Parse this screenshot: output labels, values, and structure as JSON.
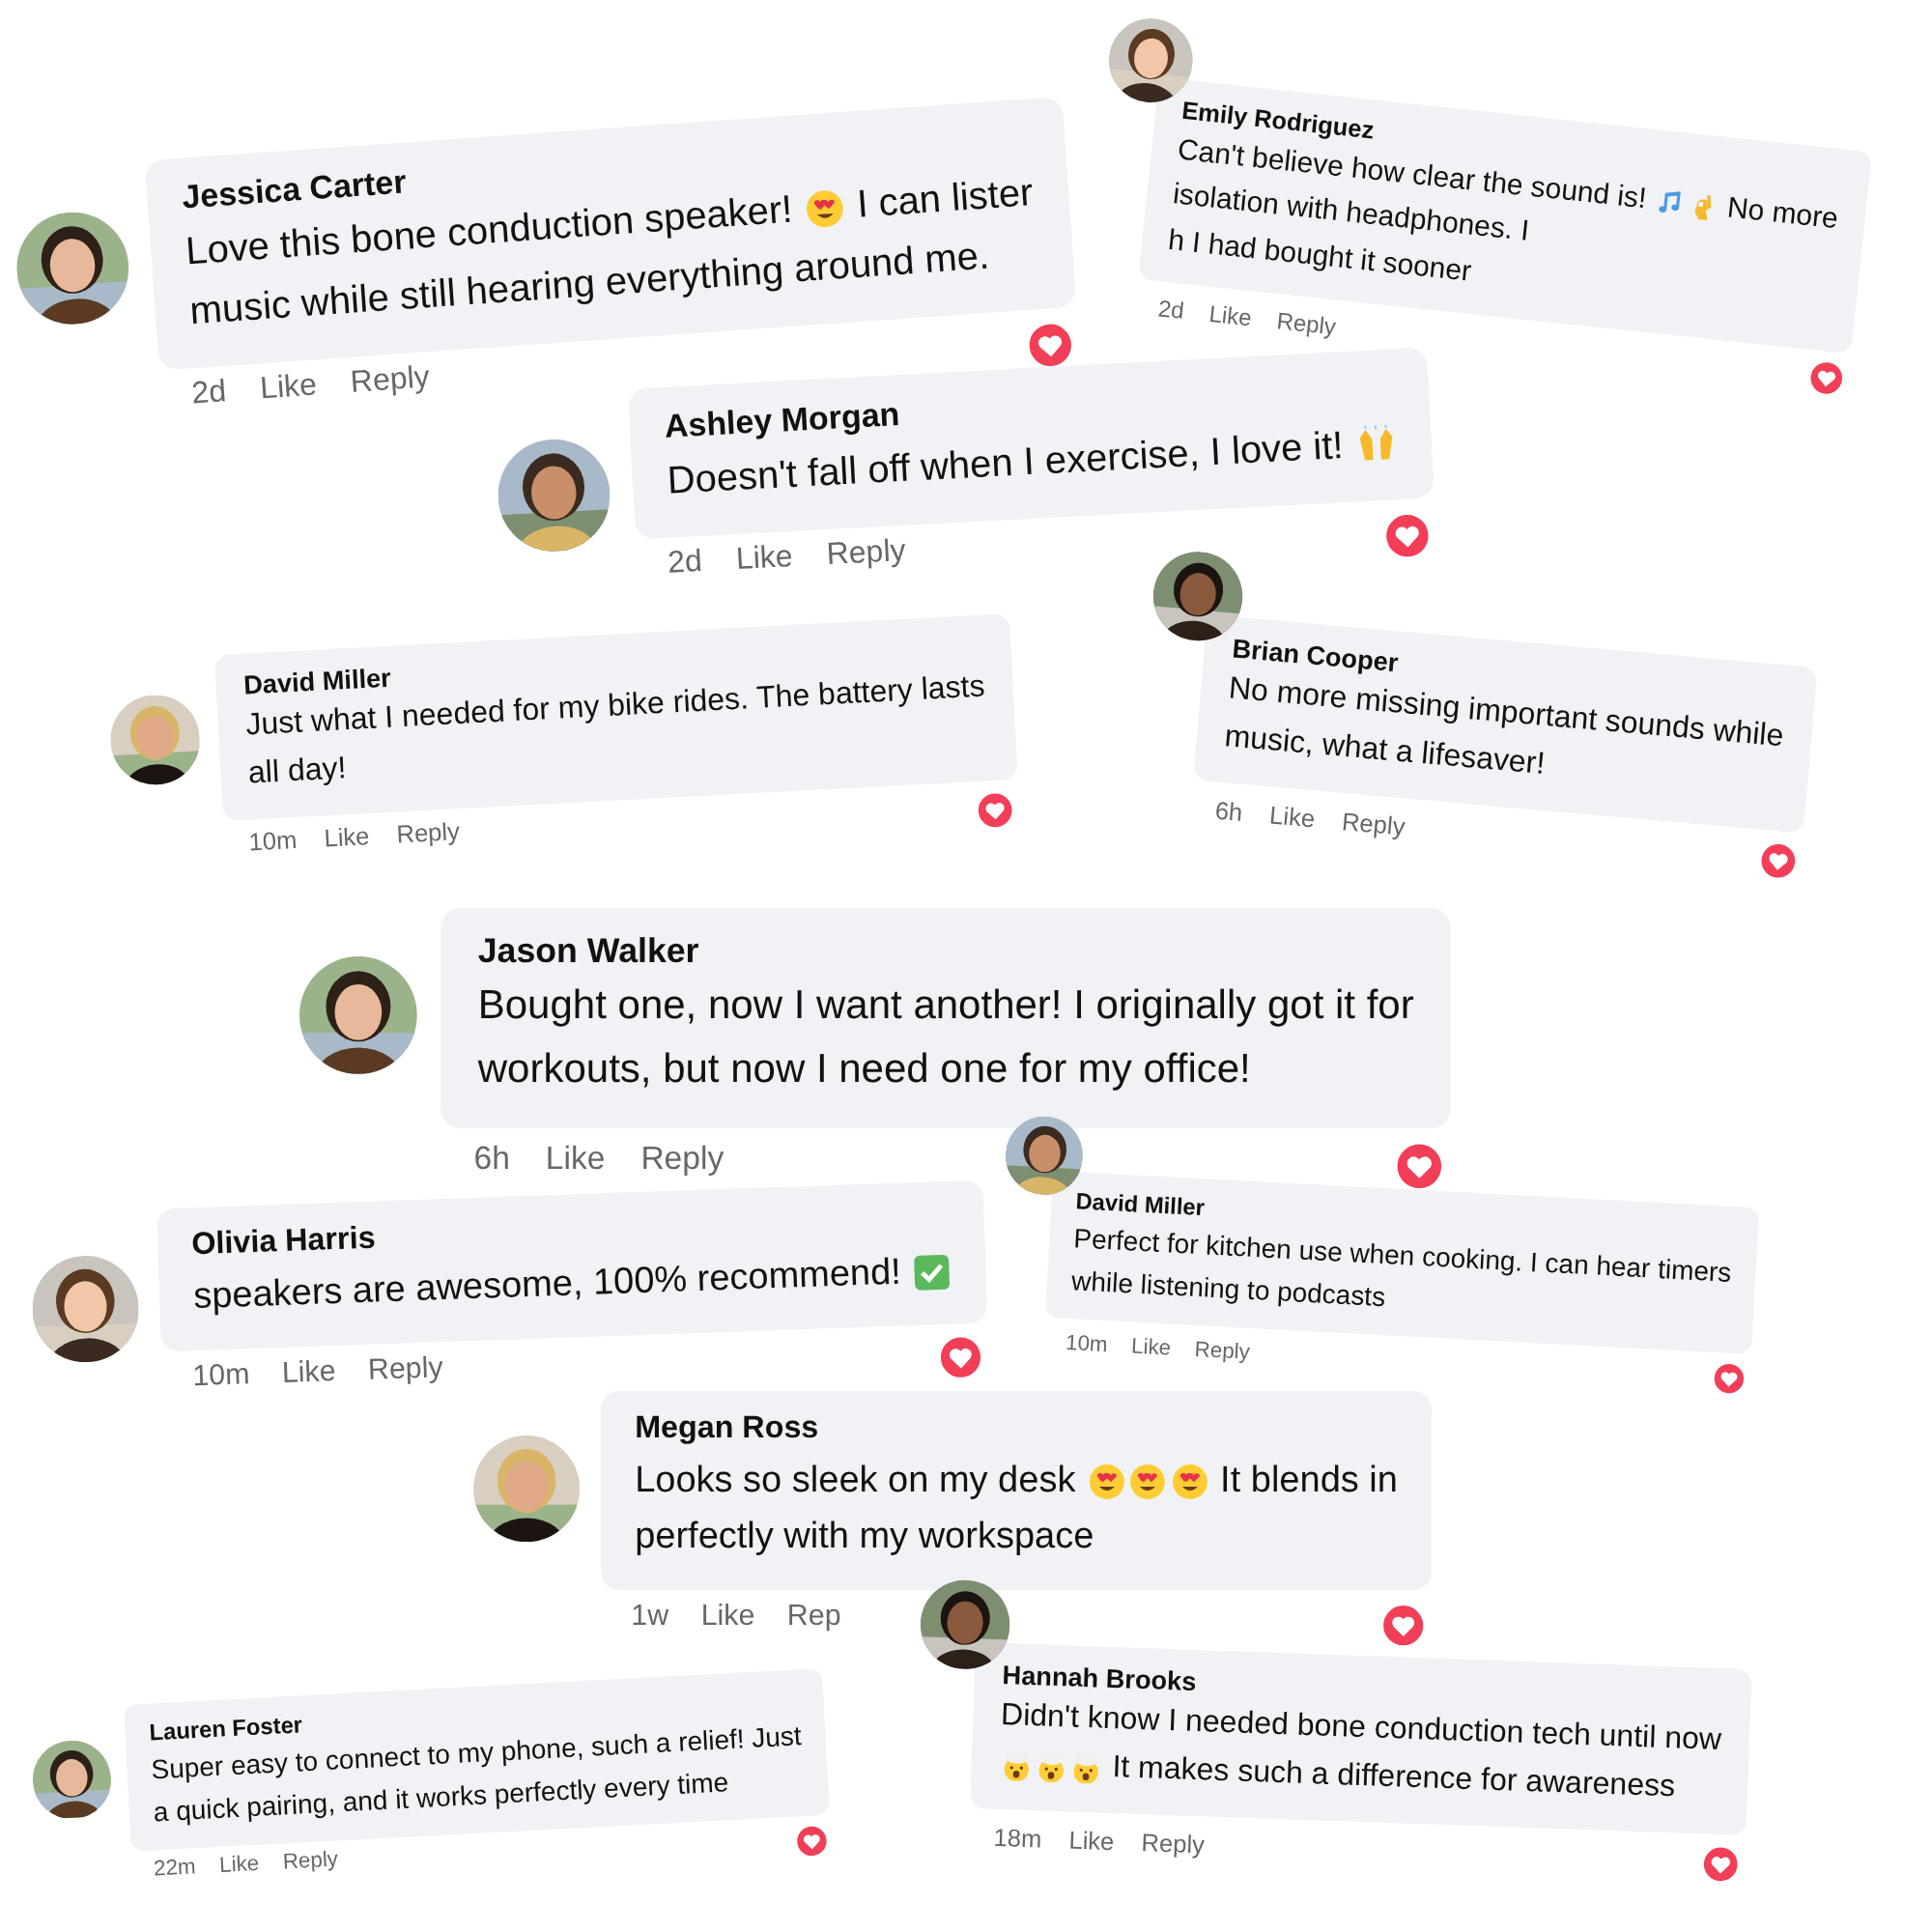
{
  "comments": [
    {
      "name": "Jessica Carter",
      "lines": [
        [
          {
            "kind": "text",
            "text": "Love this bone conduction speaker! "
          },
          {
            "kind": "heart-eyes"
          },
          {
            "kind": "text",
            "text": " I can lister"
          }
        ],
        [
          {
            "kind": "text",
            "text": "music while still hearing everything around me."
          }
        ]
      ],
      "time": "2d",
      "like": "Like",
      "reply": "Reply"
    },
    {
      "name": "Emily Rodriguez",
      "lines": [
        [
          {
            "kind": "text",
            "text": "Can't believe how clear the sound is! "
          },
          {
            "kind": "notes"
          },
          {
            "kind": "ok-hand"
          },
          {
            "kind": "text",
            "text": " No more"
          }
        ],
        [
          {
            "kind": "text",
            "text": "isolation with headphones. I"
          }
        ],
        [
          {
            "kind": "text",
            "text": "h I had bought it sooner"
          }
        ]
      ],
      "time": "2d",
      "like": "Like",
      "reply": "Reply"
    },
    {
      "name": "Ashley Morgan",
      "lines": [
        [
          {
            "kind": "text",
            "text": "Doesn't fall off when I exercise, I love it! "
          },
          {
            "kind": "raised-hands"
          }
        ]
      ],
      "time": "2d",
      "like": "Like",
      "reply": "Reply"
    },
    {
      "name": "David Miller",
      "lines": [
        [
          {
            "kind": "text",
            "text": "Just what I needed for my bike rides. The battery lasts"
          }
        ],
        [
          {
            "kind": "text",
            "text": "all day!"
          }
        ]
      ],
      "time": "10m",
      "like": "Like",
      "reply": "Reply"
    },
    {
      "name": "Brian Cooper",
      "lines": [
        [
          {
            "kind": "text",
            "text": "No more missing important sounds while"
          }
        ],
        [
          {
            "kind": "text",
            "text": "music, what a lifesaver!"
          }
        ]
      ],
      "time": "6h",
      "like": "Like",
      "reply": "Reply"
    },
    {
      "name": "Jason Walker",
      "lines": [
        [
          {
            "kind": "text",
            "text": "Bought one, now I want another! I originally got it for"
          }
        ],
        [
          {
            "kind": "text",
            "text": "workouts, but now I need one for my office!"
          }
        ]
      ],
      "time": "6h",
      "like": "Like",
      "reply": "Reply"
    },
    {
      "name": "Olivia Harris",
      "lines": [
        [
          {
            "kind": "text",
            "text": "speakers are awesome, 100% recommend! "
          },
          {
            "kind": "check"
          }
        ]
      ],
      "time": "10m",
      "like": "Like",
      "reply": "Reply"
    },
    {
      "name": "David Miller",
      "lines": [
        [
          {
            "kind": "text",
            "text": "Perfect for kitchen use when cooking. I can hear timers"
          }
        ],
        [
          {
            "kind": "text",
            "text": "while listening to podcasts"
          }
        ]
      ],
      "time": "10m",
      "like": "Like",
      "reply": "Reply"
    },
    {
      "name": "Megan Ross",
      "lines": [
        [
          {
            "kind": "text",
            "text": "Looks so sleek on my desk "
          },
          {
            "kind": "heart-eyes"
          },
          {
            "kind": "heart-eyes"
          },
          {
            "kind": "heart-eyes"
          },
          {
            "kind": "text",
            "text": " It blends in"
          }
        ],
        [
          {
            "kind": "text",
            "text": "perfectly with my workspace"
          }
        ]
      ],
      "time": "1w",
      "like": "Like",
      "reply": "Rep"
    },
    {
      "name": "Hannah Brooks",
      "lines": [
        [
          {
            "kind": "text",
            "text": "Didn't know I needed bone conduction tech until now"
          }
        ],
        [
          {
            "kind": "mind-blown"
          },
          {
            "kind": "mind-blown"
          },
          {
            "kind": "mind-blown"
          },
          {
            "kind": "text",
            "text": " It makes such a difference for awareness"
          }
        ]
      ],
      "time": "18m",
      "like": "Like",
      "reply": "Reply"
    },
    {
      "name": "Lauren Foster",
      "lines": [
        [
          {
            "kind": "text",
            "text": "Super easy to connect to my phone, such a relief! Just"
          }
        ],
        [
          {
            "kind": "text",
            "text": "a quick pairing, and it works perfectly every time"
          }
        ]
      ],
      "time": "22m",
      "like": "Like",
      "reply": "Reply"
    }
  ]
}
